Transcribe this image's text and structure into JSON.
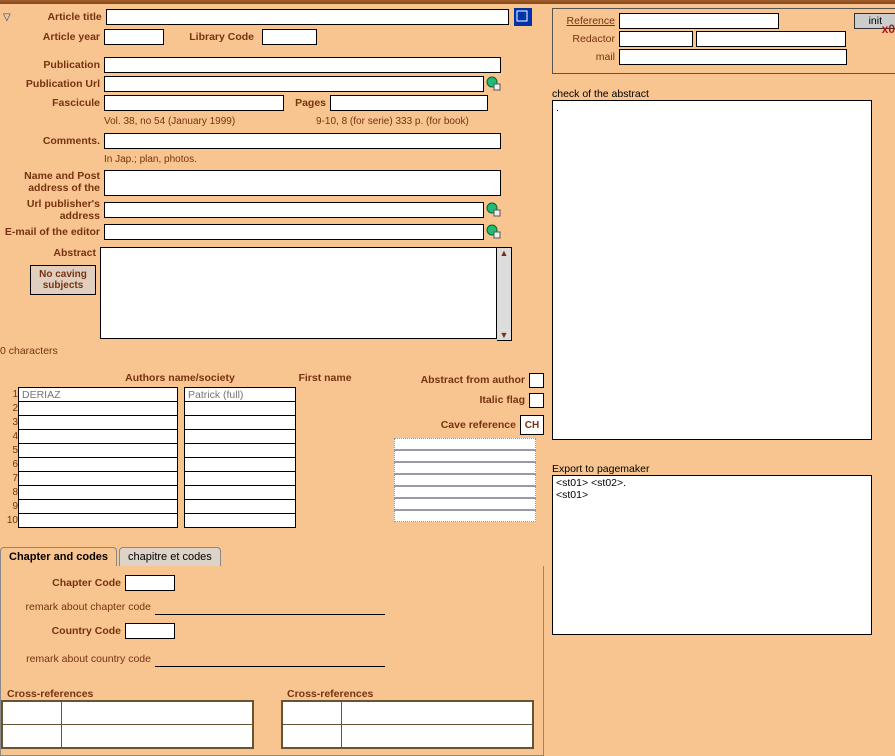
{
  "header": {
    "x_marker": "x0"
  },
  "left": {
    "article_title_label": "Article title",
    "article_title_value": "",
    "article_year_label": "Article year",
    "article_year_value": "",
    "library_code_label": "Library Code",
    "library_code_value": "",
    "publication_label": "Publication",
    "publication_value": "",
    "publication_url_label": "Publication Url",
    "publication_url_value": "",
    "fascicule_label": "Fascicule",
    "fascicule_value": "",
    "pages_label": "Pages",
    "pages_value": "",
    "fascicule_hint": "Vol. 38, no 54 (January 1999)",
    "pages_hint": "9-10, 8 (for serie)    333 p. (for book)",
    "comments_label": "Comments.",
    "comments_value": "",
    "comments_hint": "In Jap.; plan, photos.",
    "name_post_label_1": "Name and Post",
    "name_post_label_2": "address of the",
    "name_post_value": "",
    "url_pub_label_1": "Url publisher's",
    "url_pub_label_2": "address",
    "url_pub_value": "",
    "email_editor_label": "E-mail of the editor",
    "email_editor_value": "",
    "abstract_label": "Abstract",
    "abstract_value": "",
    "no_subj_btn": "No caving subjects",
    "char_count": "0 characters",
    "authors_name_header": "Authors name/society",
    "first_name_header": "First name",
    "authors": [
      {
        "n": "1",
        "name": "DERIAZ",
        "first": "Patrick (full)"
      },
      {
        "n": "2",
        "name": "",
        "first": ""
      },
      {
        "n": "3",
        "name": "",
        "first": ""
      },
      {
        "n": "4",
        "name": "",
        "first": ""
      },
      {
        "n": "5",
        "name": "",
        "first": ""
      },
      {
        "n": "6",
        "name": "",
        "first": ""
      },
      {
        "n": "7",
        "name": "",
        "first": ""
      },
      {
        "n": "8",
        "name": "",
        "first": ""
      },
      {
        "n": "9",
        "name": "",
        "first": ""
      },
      {
        "n": "10",
        "name": "",
        "first": ""
      }
    ],
    "abs_from_author_label": "Abstract from author",
    "italic_flag_label": "Italic flag",
    "cave_ref_label": "Cave reference",
    "cave_ref_btn": "CH",
    "tab1": "Chapter and codes",
    "tab2": "chapitre et codes",
    "chapter_code_label": "Chapter Code",
    "chapter_code_value": "",
    "remark_chapter_label": "remark about chapter code",
    "remark_chapter_value": "",
    "country_code_label": "Country Code",
    "country_code_value": "",
    "remark_country_label": "remark about country code",
    "remark_country_value": "",
    "cross_ref_label": "Cross-references"
  },
  "right": {
    "reference_label": "Reference",
    "reference_value": "",
    "init_btn": "init",
    "redactor_label": "Redactor",
    "redactor_value_1": "",
    "redactor_value_2": "",
    "mail_label": "mail",
    "mail_value": "",
    "check_abstract_label": "check of the abstract",
    "check_abstract_value": ".",
    "export_label": "Export to pagemaker",
    "export_value": "<st01> <st02>.\n<st01>"
  }
}
